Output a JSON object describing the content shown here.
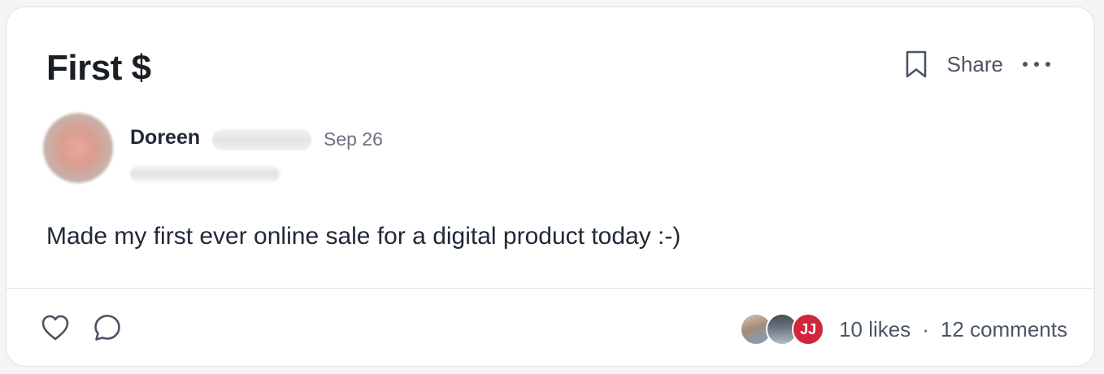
{
  "post": {
    "title": "First $",
    "body": "Made my first ever online sale for a digital product today :-)"
  },
  "header_actions": {
    "bookmark_icon": "bookmark-icon",
    "share_label": "Share",
    "more_icon": "more-horizontal-icon"
  },
  "author": {
    "name": "Doreen",
    "date": "Sep 26"
  },
  "footer": {
    "like_icon": "heart-icon",
    "comment_icon": "comment-bubble-icon",
    "liker_avatars": [
      {
        "type": "photo"
      },
      {
        "type": "photo"
      },
      {
        "type": "initials",
        "initials": "JJ",
        "color": "#d0253b"
      }
    ],
    "likes_label": "10 likes",
    "separator": "·",
    "comments_label": "12 comments"
  },
  "colors": {
    "card_background": "#ffffff",
    "page_background": "#f3f4f6",
    "text_primary": "#1f2937",
    "text_secondary": "#4b5563",
    "text_muted": "#6b7280",
    "border": "#dfe2e6"
  }
}
